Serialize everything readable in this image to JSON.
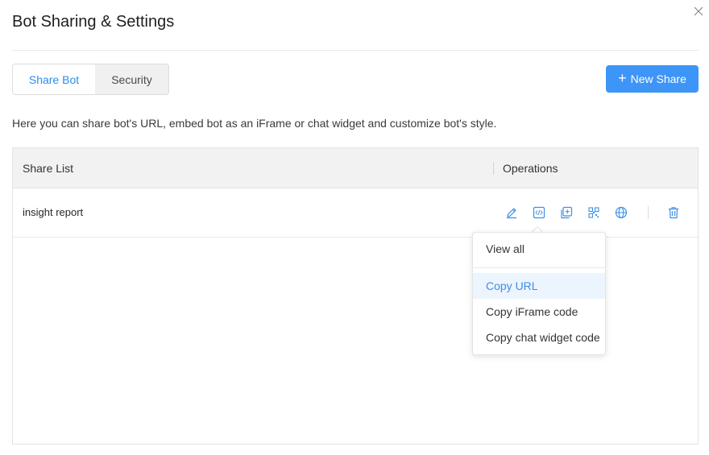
{
  "dialog": {
    "title": "Bot Sharing & Settings"
  },
  "tabs": [
    {
      "label": "Share Bot",
      "active": true
    },
    {
      "label": "Security",
      "active": false
    }
  ],
  "new_share_button": {
    "icon": "plus-icon",
    "label": "New Share"
  },
  "description": "Here you can share bot's URL, embed bot as an iFrame or chat widget and customize bot's style.",
  "table": {
    "columns": [
      "Share List",
      "Operations"
    ],
    "rows": [
      {
        "name": "insight report",
        "operations": [
          "edit-icon",
          "embed-code-icon",
          "copy-icon",
          "qr-code-icon",
          "globe-icon",
          "delete-icon"
        ]
      }
    ]
  },
  "dropdown": {
    "items": [
      "View all",
      "Copy URL",
      "Copy iFrame code",
      "Copy chat widget code"
    ],
    "highlighted": "Copy URL"
  },
  "colors": {
    "accent": "#3d95f7",
    "link": "#2d8cf0",
    "header_bg": "#f2f2f2",
    "highlight_bg": "#ecf4fe"
  }
}
